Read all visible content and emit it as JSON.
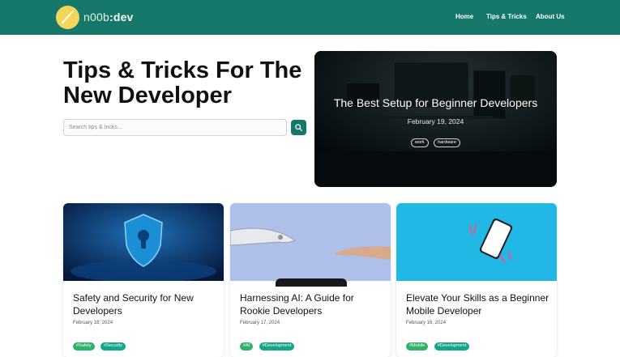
{
  "brand": {
    "name_part1": "n00b",
    "name_part2": ":dev",
    "logo_icon": "rocket-icon"
  },
  "nav": {
    "home": "Home",
    "tips": "Tips & Tricks",
    "about": "About Us"
  },
  "hero": {
    "title": "Tips & Tricks For The New Developer"
  },
  "search": {
    "placeholder": "Search tips & tricks...",
    "button_icon": "search-icon"
  },
  "featured": {
    "title": "The Best Setup for Beginner Developers",
    "date": "February 19, 2024",
    "tags": [
      "work",
      "hardware"
    ]
  },
  "cards": [
    {
      "title": "Safety and Security for New Developers",
      "date": "February 18, 2024",
      "tags": [
        "#Safety",
        "#Security"
      ]
    },
    {
      "title": "Harnessing AI: A Guide for Rookie Developers",
      "date": "February 17, 2024",
      "tags": [
        "#AI",
        "#Development"
      ]
    },
    {
      "title": "Elevate Your Skills as a Beginner Mobile Developer",
      "date": "February 16, 2024",
      "tags": [
        "#Mobile",
        "#Development"
      ]
    }
  ],
  "colors": {
    "brand": "#16786a",
    "accent_yellow": "#f1d65a",
    "tag_green": "#2fb36a",
    "tag_teal": "#17a58a"
  }
}
